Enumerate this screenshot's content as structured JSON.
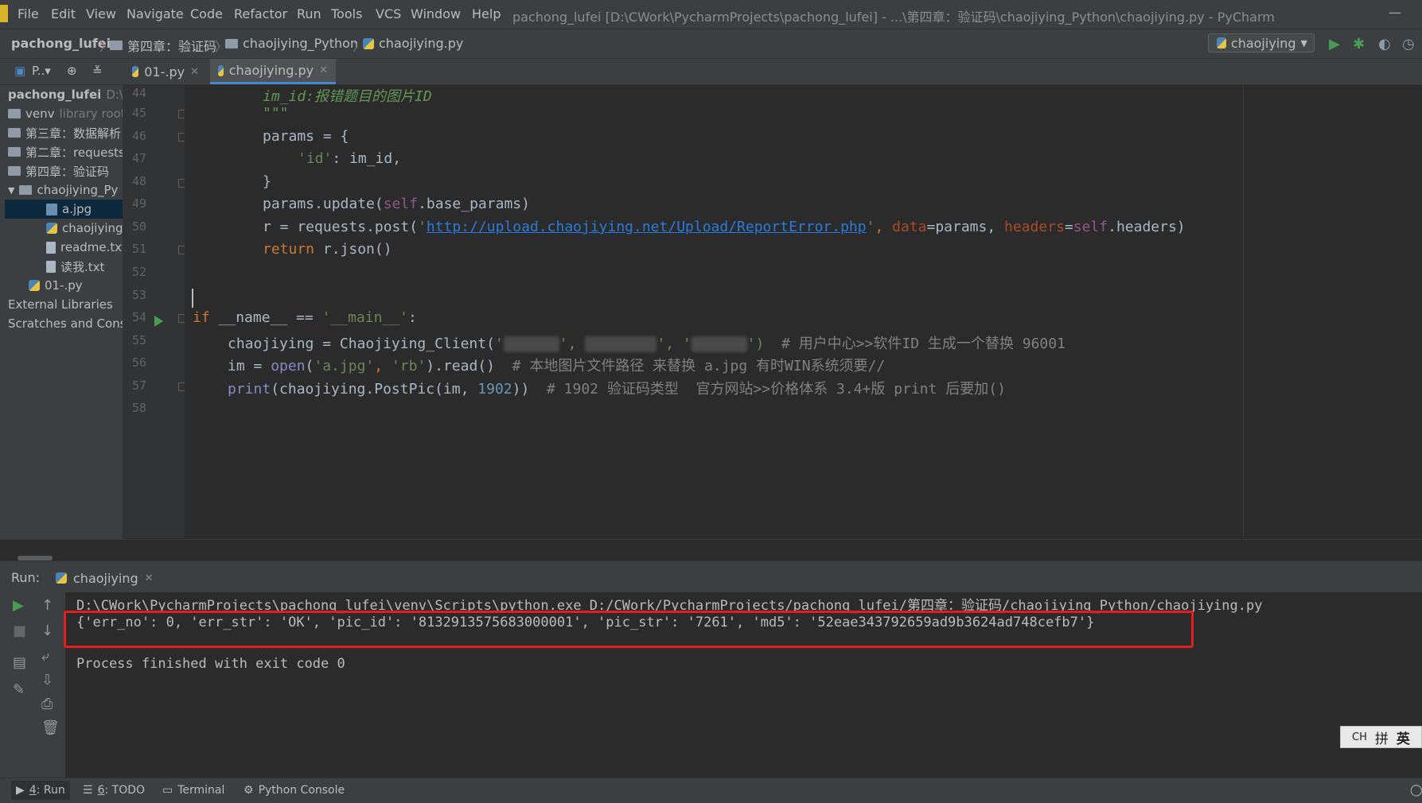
{
  "menubar": {
    "items": [
      "File",
      "Edit",
      "View",
      "Navigate",
      "Code",
      "Refactor",
      "Run",
      "Tools",
      "VCS",
      "Window",
      "Help"
    ],
    "title": "pachong_lufei [D:\\CWork\\PycharmProjects\\pachong_lufei] - ...\\第四章：验证码\\chaojiying_Python\\chaojiying.py - PyCharm"
  },
  "navbar": {
    "crumbs": [
      "pachong_lufei",
      "第四章：验证码",
      "chaojiying_Python",
      "chaojiying.py"
    ],
    "run_config": "chaojiying"
  },
  "project_strip": {
    "label": "P..▾"
  },
  "tabs": [
    {
      "label": "01-.py",
      "active": false
    },
    {
      "label": "chaojiying.py",
      "active": true
    }
  ],
  "project_tree": [
    {
      "label": "pachong_lufei",
      "suffix": "D:\\C"
    },
    {
      "label": "venv",
      "suffix": "library root"
    },
    {
      "label": "第三章：数据解析",
      "suffix": ""
    },
    {
      "label": "第二章：requests",
      "suffix": ""
    },
    {
      "label": "第四章：验证码",
      "suffix": ""
    },
    {
      "label": "chaojiying_Py",
      "suffix": ""
    },
    {
      "label": "a.jpg",
      "suffix": ""
    },
    {
      "label": "chaojiying.",
      "suffix": ""
    },
    {
      "label": "readme.txt",
      "suffix": ""
    },
    {
      "label": "读我.txt",
      "suffix": ""
    },
    {
      "label": "01-.py",
      "suffix": ""
    },
    {
      "label": "External Libraries",
      "suffix": ""
    },
    {
      "label": "Scratches and Conso",
      "suffix": ""
    }
  ],
  "line_numbers": [
    "44",
    "45",
    "46",
    "47",
    "48",
    "49",
    "50",
    "51",
    "52",
    "53",
    "54",
    "55",
    "56",
    "57",
    "58"
  ],
  "code": {
    "l44": "im_id:报错题目的图片ID",
    "l45": "\"\"\"",
    "l46a": "params = {",
    "l47a": "'id'",
    "l47b": ": im_id,",
    "l48": "}",
    "l49a": "params.update(",
    "l49b": "self",
    "l49c": ".base_params)",
    "l50a": "r = requests.post(",
    "l50b": "'",
    "l50url": "http://upload.chaojiying.net/Upload/ReportError.php",
    "l50c": "'",
    "l50d": ", ",
    "l50e": "data",
    "l50f": "=params, ",
    "l50g": "headers",
    "l50h": "=",
    "l50i": "self",
    "l50j": ".headers)",
    "l51a": "return",
    "l51b": " r.json()",
    "l54a": "if",
    "l54b": " __name__ == ",
    "l54c": "'__main__'",
    "l54d": ":",
    "l55a": "chaojiying = Chaojiying_Client(",
    "l55b": "'",
    "l55c": "', ",
    "l55d": "'",
    "l55e": "', '",
    "l55f": "')",
    "l55g": "  # 用户中心>>软件ID 生成一个替换 96001",
    "l56a": "im = ",
    "l56b": "open",
    "l56c": "(",
    "l56d": "'a.jpg'",
    "l56e": ", ",
    "l56f": "'rb'",
    "l56g": ").read()",
    "l56h": "  # 本地图片文件路径 来替换 a.jpg 有时WIN系统须要//",
    "l57a": "print",
    "l57b": "(chaojiying.PostPic(im, ",
    "l57c": "1902",
    "l57d": "))",
    "l57e": "  # 1902 验证码类型  官方网站>>价格体系 3.4+版 print 后要加()"
  },
  "run_panel": {
    "label": "Run:",
    "tab": "chaojiying",
    "line1": "D:\\CWork\\PycharmProjects\\pachong_lufei\\venv\\Scripts\\python.exe D:/CWork/PycharmProjects/pachong_lufei/第四章：验证码/chaojiying_Python/chaojiying.py",
    "line2": "{'err_no': 0, 'err_str': 'OK', 'pic_id': '8132913575683000001', 'pic_str': '7261', 'md5': '52eae343792659ad9b3624ad748cefb7'}",
    "line3": "Process finished with exit code 0"
  },
  "ime": {
    "a": "CH",
    "b": "拼",
    "c": "英"
  },
  "bottom_tools": [
    {
      "prefix": "4",
      "label": ": Run"
    },
    {
      "prefix": "6",
      "label": ": TODO"
    },
    {
      "prefix": "",
      "label": "Terminal"
    },
    {
      "prefix": "",
      "label": "Python Console"
    }
  ],
  "colors": {
    "background": "#2b2b2b",
    "keyword": "#cc7832",
    "string": "#6a8759",
    "number": "#6897bb",
    "comment": "#808080",
    "highlight_box": "#e51c1c",
    "run_green": "#499c54"
  }
}
